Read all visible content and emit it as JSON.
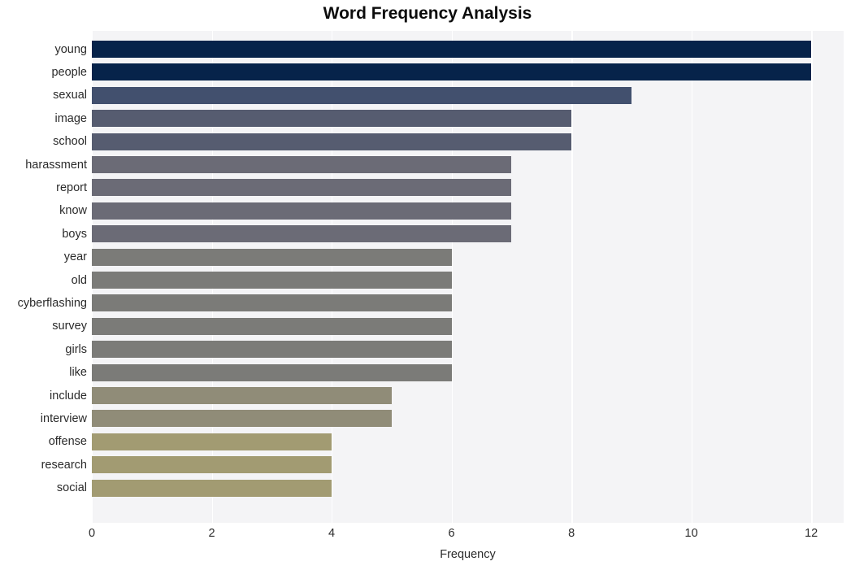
{
  "chart_data": {
    "type": "bar",
    "orientation": "horizontal",
    "title": "Word Frequency Analysis",
    "xlabel": "Frequency",
    "ylabel": "",
    "categories": [
      "young",
      "people",
      "sexual",
      "image",
      "school",
      "harassment",
      "report",
      "know",
      "boys",
      "year",
      "old",
      "cyberflashing",
      "survey",
      "girls",
      "like",
      "include",
      "interview",
      "offense",
      "research",
      "social"
    ],
    "values": [
      12,
      12,
      9,
      8,
      8,
      7,
      7,
      7,
      7,
      6,
      6,
      6,
      6,
      6,
      6,
      5,
      5,
      4,
      4,
      4
    ],
    "bar_colors": [
      "#06234a",
      "#06234a",
      "#42506e",
      "#565c70",
      "#565c70",
      "#6b6b76",
      "#6b6b76",
      "#6b6b76",
      "#6b6b76",
      "#7b7b78",
      "#7b7b78",
      "#7b7b78",
      "#7b7b78",
      "#7b7b78",
      "#7b7b78",
      "#908c78",
      "#908c78",
      "#a29b72",
      "#a29b72",
      "#a29b72"
    ],
    "xlim": [
      0,
      12.54
    ],
    "xticks": [
      0,
      2,
      4,
      6,
      8,
      10,
      12
    ],
    "xtick_labels": [
      "0",
      "2",
      "4",
      "6",
      "8",
      "10",
      "12"
    ],
    "grid": true,
    "grid_color": "#ffffff",
    "plot_background": "#f4f4f6",
    "figure_background": "#ffffff",
    "legend": null
  }
}
